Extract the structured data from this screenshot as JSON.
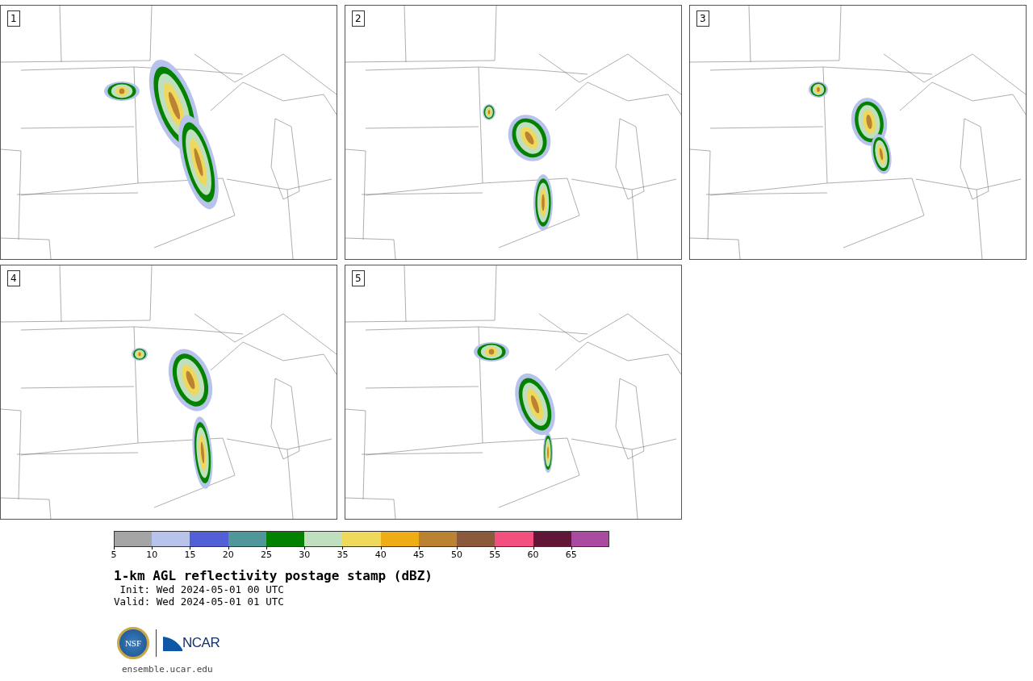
{
  "panels": [
    {
      "label": "1"
    },
    {
      "label": "2"
    },
    {
      "label": "3"
    },
    {
      "label": "4"
    },
    {
      "label": "5"
    }
  ],
  "colorbar": [
    {
      "color": "#a5a5a5",
      "tick": "5"
    },
    {
      "color": "#b8c3ec",
      "tick": "10"
    },
    {
      "color": "#525fd6",
      "tick": "15"
    },
    {
      "color": "#50979b",
      "tick": "20"
    },
    {
      "color": "#028200",
      "tick": "25"
    },
    {
      "color": "#bfdfbf",
      "tick": "30"
    },
    {
      "color": "#efd95c",
      "tick": "35"
    },
    {
      "color": "#eeac15",
      "tick": "40"
    },
    {
      "color": "#bb8231",
      "tick": "45"
    },
    {
      "color": "#8b5a3d",
      "tick": "50"
    },
    {
      "color": "#f35080",
      "tick": "55"
    },
    {
      "color": "#621637",
      "tick": "60"
    },
    {
      "color": "#aa4ba1",
      "tick": "65"
    }
  ],
  "title": "1-km AGL reflectivity postage stamp (dBZ)",
  "init": "Init: Wed 2024-05-01 00 UTC",
  "valid": "Valid: Wed 2024-05-01 01 UTC",
  "logo": {
    "seal": "NSF",
    "wordmark": "NCAR"
  },
  "site": "ensemble.ucar.edu"
}
